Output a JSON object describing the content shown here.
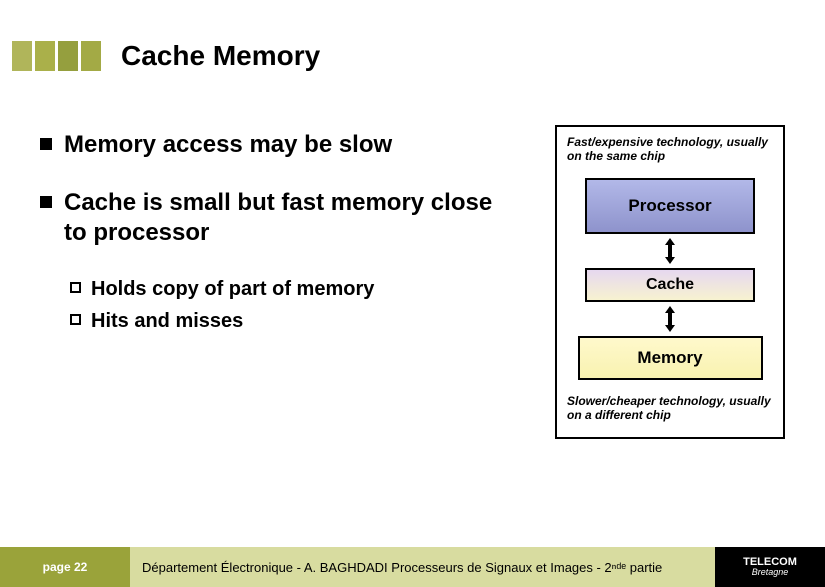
{
  "title": "Cache Memory",
  "bullets": [
    {
      "text": "Memory access may be slow"
    },
    {
      "text": "Cache is small but fast memory close to processor",
      "sub": [
        {
          "text": "Holds copy of part of memory"
        },
        {
          "text": "Hits and misses"
        }
      ]
    }
  ],
  "diagram": {
    "top_note": "Fast/expensive technology, usually on the same chip",
    "processor": "Processor",
    "cache": "Cache",
    "memory": "Memory",
    "bottom_note": "Slower/cheaper technology, usually on a different chip"
  },
  "footer": {
    "page": "page 22",
    "dept": "Département Électronique - A. BAGHDADI   Processeurs de Signaux et Images - 2ⁿᵈᵉ partie",
    "brand_top": "TELECOM",
    "brand_bottom": "Bretagne"
  }
}
